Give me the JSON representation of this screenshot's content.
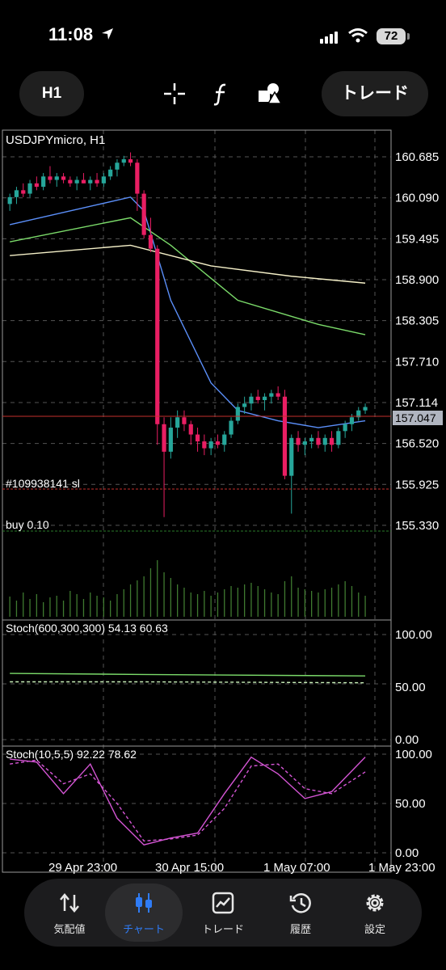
{
  "status_bar": {
    "time": "11:08",
    "battery": "72"
  },
  "toolbar": {
    "timeframe": "H1",
    "trade_label": "トレード"
  },
  "chart": {
    "symbol_label": "USDJPYmicro, H1",
    "price_ticks": [
      "160.685",
      "160.090",
      "159.495",
      "158.900",
      "158.305",
      "157.710",
      "157.114",
      "156.520",
      "155.925",
      "155.330"
    ],
    "current_price": "157.047",
    "order_sl_label": "#109938141 sl",
    "order_buy_label": "buy 0.10",
    "time_labels": [
      "29 Apr 23:00",
      "30 Apr 15:00",
      "1 May 07:00",
      "1 May 23:00"
    ],
    "colors": {
      "bull": "#26a69a",
      "bear": "#e91e63",
      "ma_fast": "#5b8ff9",
      "ma_mid": "#7bdb6a",
      "ma_slow": "#f5f0c8"
    }
  },
  "stoch1": {
    "label": "Stoch(600,300,300) 54.13 60.63",
    "ticks": [
      "100.00",
      "50.00",
      "0.00"
    ]
  },
  "stoch2": {
    "label": "Stoch(10,5,5) 92.22 78.62",
    "ticks": [
      "100.00",
      "50.00",
      "0.00"
    ]
  },
  "nav": {
    "items": [
      {
        "label": "気配値",
        "icon": "arrows-updown-icon"
      },
      {
        "label": "チャート",
        "icon": "candles-icon"
      },
      {
        "label": "トレード",
        "icon": "trade-chart-icon"
      },
      {
        "label": "履歴",
        "icon": "history-icon"
      },
      {
        "label": "設定",
        "icon": "gear-icon"
      }
    ],
    "active_index": 1
  },
  "chart_data": {
    "type": "line",
    "title": "USDJPYmicro, H1",
    "x_labels": [
      "29 Apr 23:00",
      "30 Apr 15:00",
      "1 May 07:00",
      "1 May 23:00"
    ],
    "ylim": [
      155.0,
      160.85
    ],
    "candles": [
      [
        160.0,
        160.15,
        159.9,
        160.1
      ],
      [
        160.1,
        160.25,
        160.0,
        160.2
      ],
      [
        160.2,
        160.3,
        160.1,
        160.15
      ],
      [
        160.15,
        160.35,
        160.1,
        160.3
      ],
      [
        160.3,
        160.4,
        160.2,
        160.25
      ],
      [
        160.25,
        160.45,
        160.2,
        160.4
      ],
      [
        160.4,
        160.55,
        160.3,
        160.35
      ],
      [
        160.35,
        160.45,
        160.25,
        160.4
      ],
      [
        160.4,
        160.45,
        160.3,
        160.35
      ],
      [
        160.35,
        160.4,
        160.25,
        160.3
      ],
      [
        160.3,
        160.4,
        160.2,
        160.35
      ],
      [
        160.35,
        160.45,
        160.3,
        160.3
      ],
      [
        160.3,
        160.4,
        160.2,
        160.35
      ],
      [
        160.35,
        160.45,
        160.25,
        160.3
      ],
      [
        160.3,
        160.45,
        160.25,
        160.4
      ],
      [
        160.4,
        160.55,
        160.35,
        160.5
      ],
      [
        160.5,
        160.65,
        160.4,
        160.6
      ],
      [
        160.6,
        160.7,
        160.55,
        160.65
      ],
      [
        160.65,
        160.75,
        160.55,
        160.6
      ],
      [
        160.6,
        160.65,
        159.9,
        160.15
      ],
      [
        160.15,
        160.2,
        159.5,
        159.55
      ],
      [
        159.55,
        159.8,
        159.3,
        159.35
      ],
      [
        159.35,
        159.4,
        156.5,
        156.8
      ],
      [
        156.8,
        156.9,
        155.45,
        156.4
      ],
      [
        156.4,
        156.9,
        156.3,
        156.75
      ],
      [
        156.75,
        157.0,
        156.6,
        156.9
      ],
      [
        156.9,
        157.0,
        156.7,
        156.8
      ],
      [
        156.8,
        156.85,
        156.5,
        156.65
      ],
      [
        156.65,
        156.75,
        156.4,
        156.55
      ],
      [
        156.55,
        156.65,
        156.35,
        156.45
      ],
      [
        156.45,
        156.6,
        156.35,
        156.55
      ],
      [
        156.55,
        156.65,
        156.45,
        156.5
      ],
      [
        156.5,
        156.7,
        156.4,
        156.65
      ],
      [
        156.65,
        156.9,
        156.6,
        156.85
      ],
      [
        156.85,
        157.1,
        156.8,
        157.05
      ],
      [
        157.05,
        157.2,
        156.95,
        157.1
      ],
      [
        157.1,
        157.25,
        157.0,
        157.2
      ],
      [
        157.2,
        157.3,
        157.1,
        157.15
      ],
      [
        157.15,
        157.25,
        157.0,
        157.2
      ],
      [
        157.2,
        157.3,
        157.1,
        157.25
      ],
      [
        157.25,
        157.35,
        157.15,
        157.2
      ],
      [
        157.2,
        157.3,
        156.0,
        156.05
      ],
      [
        156.05,
        156.65,
        155.5,
        156.6
      ],
      [
        156.6,
        156.7,
        156.4,
        156.5
      ],
      [
        156.5,
        156.6,
        156.35,
        156.55
      ],
      [
        156.55,
        156.65,
        156.45,
        156.6
      ],
      [
        156.6,
        156.7,
        156.45,
        156.5
      ],
      [
        156.5,
        156.65,
        156.4,
        156.6
      ],
      [
        156.6,
        156.7,
        156.4,
        156.5
      ],
      [
        156.5,
        156.75,
        156.45,
        156.7
      ],
      [
        156.7,
        156.85,
        156.6,
        156.8
      ],
      [
        156.8,
        156.95,
        156.7,
        156.9
      ],
      [
        156.9,
        157.05,
        156.85,
        157.0
      ],
      [
        157.0,
        157.1,
        156.95,
        157.05
      ]
    ],
    "volumes": [
      25,
      20,
      30,
      22,
      28,
      18,
      24,
      26,
      20,
      32,
      28,
      22,
      30,
      26,
      24,
      20,
      28,
      34,
      40,
      45,
      50,
      60,
      70,
      55,
      48,
      40,
      36,
      30,
      28,
      32,
      26,
      30,
      34,
      38,
      36,
      40,
      42,
      38,
      34,
      30,
      28,
      44,
      50,
      36,
      34,
      32,
      30,
      34,
      36,
      40,
      44,
      38,
      30,
      26
    ],
    "ma_fast": [
      [
        0,
        159.7
      ],
      [
        18,
        160.1
      ],
      [
        20,
        159.9
      ],
      [
        24,
        158.6
      ],
      [
        30,
        157.4
      ],
      [
        34,
        157.0
      ],
      [
        40,
        156.85
      ],
      [
        46,
        156.75
      ],
      [
        53,
        156.85
      ]
    ],
    "ma_mid": [
      [
        0,
        159.45
      ],
      [
        18,
        159.8
      ],
      [
        24,
        159.4
      ],
      [
        34,
        158.6
      ],
      [
        46,
        158.25
      ],
      [
        53,
        158.1
      ]
    ],
    "ma_slow": [
      [
        0,
        159.25
      ],
      [
        18,
        159.4
      ],
      [
        30,
        159.1
      ],
      [
        42,
        158.95
      ],
      [
        53,
        158.85
      ]
    ],
    "order_sl_price": 156.05,
    "order_buy_price": 155.45,
    "current_price": 157.047,
    "stoch1": {
      "main": [
        [
          0,
          63
        ],
        [
          20,
          62
        ],
        [
          53,
          60.6
        ]
      ],
      "signal": [
        [
          0,
          55
        ],
        [
          20,
          55
        ],
        [
          53,
          54.1
        ]
      ]
    },
    "stoch2": {
      "main": [
        [
          0,
          95
        ],
        [
          4,
          92
        ],
        [
          8,
          60
        ],
        [
          12,
          90
        ],
        [
          16,
          35
        ],
        [
          20,
          8
        ],
        [
          24,
          15
        ],
        [
          28,
          20
        ],
        [
          32,
          60
        ],
        [
          36,
          97
        ],
        [
          40,
          80
        ],
        [
          44,
          55
        ],
        [
          48,
          62
        ],
        [
          53,
          97
        ]
      ],
      "signal": [
        [
          0,
          90
        ],
        [
          4,
          94
        ],
        [
          8,
          70
        ],
        [
          12,
          80
        ],
        [
          16,
          50
        ],
        [
          20,
          12
        ],
        [
          24,
          14
        ],
        [
          28,
          18
        ],
        [
          32,
          45
        ],
        [
          36,
          88
        ],
        [
          40,
          90
        ],
        [
          44,
          65
        ],
        [
          48,
          60
        ],
        [
          53,
          82
        ]
      ]
    }
  }
}
